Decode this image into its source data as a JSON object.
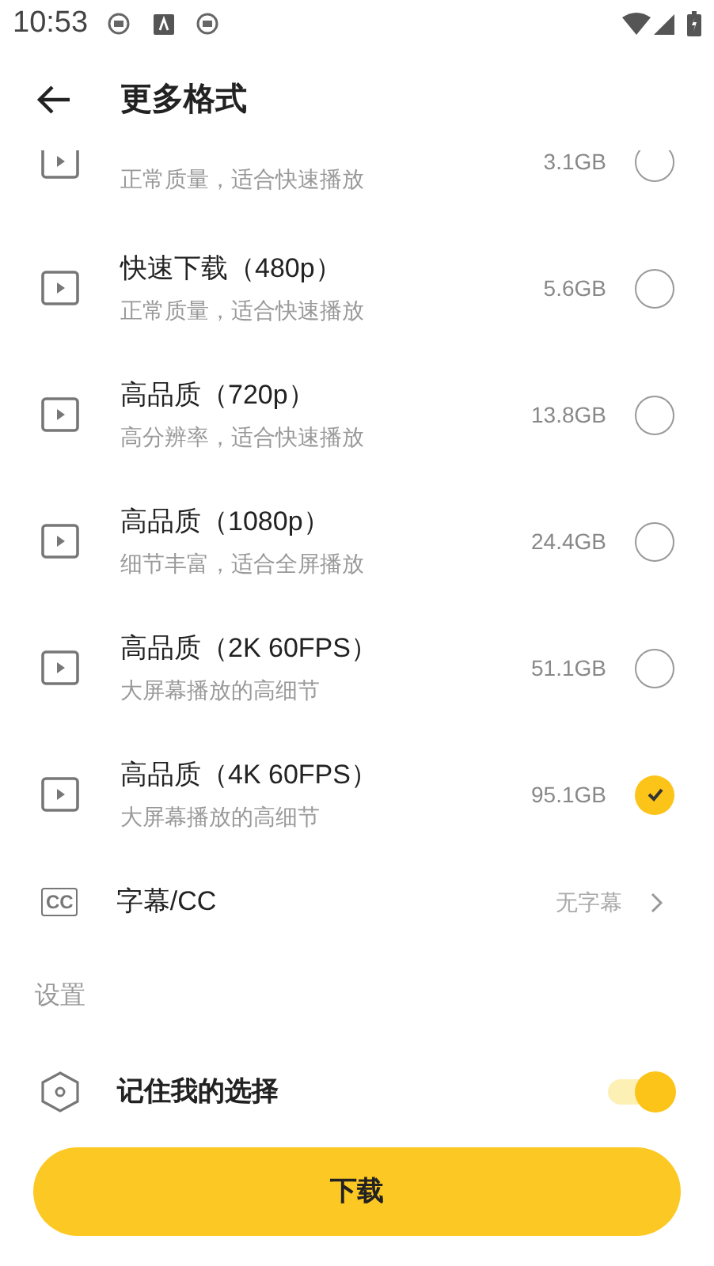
{
  "status_bar": {
    "time": "10:53"
  },
  "header": {
    "title": "更多格式"
  },
  "formats": [
    {
      "subtitle": "正常质量，适合快速播放",
      "size": "3.1GB",
      "selected": false
    },
    {
      "title": "快速下载（480p）",
      "subtitle": "正常质量，适合快速播放",
      "size": "5.6GB",
      "selected": false
    },
    {
      "title": "高品质（720p）",
      "subtitle": "高分辨率，适合快速播放",
      "size": "13.8GB",
      "selected": false
    },
    {
      "title": "高品质（1080p）",
      "subtitle": "细节丰富，适合全屏播放",
      "size": "24.4GB",
      "selected": false
    },
    {
      "title": "高品质（2K 60FPS）",
      "subtitle": "大屏幕播放的高细节",
      "size": "51.1GB",
      "selected": false
    },
    {
      "title": "高品质（4K 60FPS）",
      "subtitle": "大屏幕播放的高细节",
      "size": "95.1GB",
      "selected": true
    }
  ],
  "subtitles": {
    "icon_text": "CC",
    "label": "字幕/CC",
    "value": "无字幕"
  },
  "settings": {
    "heading": "设置",
    "remember": {
      "label": "记住我的选择",
      "on": true
    }
  },
  "download_button": "下载"
}
